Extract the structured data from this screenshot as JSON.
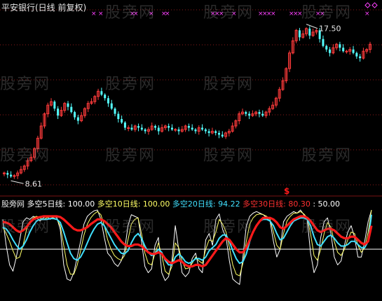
{
  "title": "平安银行(日线 前复权)",
  "watermark": "股旁网",
  "colors": {
    "background": "#000000",
    "up": "#ff3b3b",
    "down": "#54ffff",
    "grid": "#8b1a1a",
    "white": "#ffffff",
    "yellow": "#ffff66",
    "cyan": "#40e0ff",
    "red": "#ff1a1a",
    "magenta": "#ff40ff"
  },
  "legend": {
    "indicator": "股旁网",
    "s5_label": "多空5日线:",
    "s5_value": "100.00",
    "s10_label": "多空10日线:",
    "s10_value": "100.00",
    "s20_label": "多空20日线:",
    "s20_value": "94.22",
    "s30_label": "多空30日线:",
    "s30_value": "80.30",
    "level_value": ": 50.00"
  },
  "chart_data": [
    {
      "type": "candlestick",
      "title": "平安银行(日线 前复权)",
      "annotations": {
        "high": "17.50",
        "low": "8.61",
        "signal": "$"
      },
      "grid": true,
      "close": [
        8.9,
        8.8,
        8.7,
        8.75,
        8.9,
        9.1,
        9.3,
        9.6,
        9.8,
        10.3,
        10.9,
        11.6,
        12.3,
        12.8,
        13.0,
        12.6,
        12.2,
        12.5,
        12.9,
        12.7,
        12.4,
        12.1,
        11.9,
        12.2,
        12.6,
        12.9,
        13.0,
        13.3,
        13.6,
        13.4,
        13.2,
        12.9,
        12.6,
        12.3,
        12.0,
        11.8,
        11.5,
        11.5,
        11.4,
        11.6,
        11.5,
        11.4,
        11.3,
        11.4,
        11.6,
        11.5,
        11.3,
        11.5,
        11.6,
        11.5,
        11.4,
        11.4,
        11.3,
        11.4,
        11.6,
        11.5,
        11.4,
        11.3,
        11.5,
        11.4,
        11.3,
        11.2,
        11.3,
        11.2,
        11.1,
        11.0,
        11.2,
        11.3,
        11.6,
        11.9,
        12.3,
        12.4,
        12.3,
        12.2,
        12.3,
        12.4,
        12.3,
        12.2,
        12.4,
        12.6,
        12.8,
        13.2,
        13.7,
        14.2,
        14.9,
        15.8,
        16.5,
        17.1,
        16.7,
        16.9,
        17.2,
        16.8,
        17.0,
        17.1,
        16.6,
        16.2,
        16.0,
        15.8,
        16.1,
        16.3,
        16.1,
        15.9,
        15.9,
        16.0,
        15.8,
        15.6,
        15.5,
        15.9,
        16.0,
        16.3
      ]
    },
    {
      "type": "line",
      "series": [
        {
          "name": "多空5日线",
          "values": [
            88,
            55,
            30,
            22,
            40,
            62,
            85,
            90,
            88,
            92,
            90,
            86,
            90,
            92,
            88,
            92,
            90,
            75,
            30,
            12,
            10,
            20,
            40,
            60,
            82,
            92,
            96,
            99,
            100,
            88,
            65,
            45,
            40,
            32,
            28,
            35,
            48,
            80,
            94,
            92,
            90,
            60,
            28,
            20,
            25,
            55,
            65,
            20,
            10,
            15,
            35,
            80,
            50,
            20,
            15,
            20,
            38,
            45,
            25,
            20,
            62,
            70,
            55,
            88,
            95,
            75,
            65,
            35,
            12,
            8,
            5,
            40,
            80,
            92,
            96,
            98,
            96,
            94,
            90,
            86,
            60,
            40,
            50,
            85,
            92,
            95,
            98,
            96,
            100,
            94,
            88,
            45,
            20,
            30,
            65,
            85,
            90,
            70,
            40,
            30,
            35,
            55,
            72,
            80,
            65,
            40,
            40,
            60,
            85,
            100
          ]
        },
        {
          "name": "多空10日线",
          "values": [
            78,
            70,
            60,
            48,
            38,
            40,
            55,
            75,
            85,
            90,
            92,
            90,
            88,
            90,
            92,
            90,
            88,
            80,
            55,
            30,
            18,
            18,
            30,
            48,
            68,
            82,
            90,
            95,
            98,
            94,
            80,
            62,
            50,
            42,
            38,
            36,
            42,
            62,
            82,
            88,
            90,
            70,
            45,
            32,
            30,
            45,
            58,
            42,
            22,
            18,
            28,
            58,
            52,
            35,
            25,
            26,
            32,
            40,
            35,
            32,
            50,
            62,
            60,
            72,
            88,
            82,
            72,
            52,
            30,
            18,
            16,
            32,
            60,
            82,
            90,
            94,
            95,
            94,
            92,
            88,
            72,
            55,
            50,
            70,
            86,
            92,
            96,
            96,
            98,
            95,
            90,
            70,
            42,
            36,
            50,
            70,
            84,
            78,
            60,
            46,
            42,
            50,
            62,
            72,
            70,
            55,
            46,
            52,
            72,
            100
          ]
        },
        {
          "name": "多空20日线",
          "values": [
            78,
            76,
            70,
            62,
            55,
            50,
            54,
            62,
            72,
            80,
            86,
            88,
            88,
            88,
            89,
            89,
            88,
            84,
            72,
            58,
            45,
            38,
            36,
            40,
            48,
            58,
            68,
            76,
            82,
            84,
            80,
            72,
            64,
            56,
            50,
            45,
            44,
            48,
            58,
            66,
            70,
            64,
            54,
            46,
            42,
            44,
            50,
            46,
            36,
            30,
            30,
            40,
            44,
            40,
            34,
            32,
            34,
            38,
            38,
            36,
            40,
            48,
            52,
            56,
            64,
            68,
            68,
            60,
            48,
            38,
            32,
            34,
            44,
            60,
            72,
            80,
            86,
            88,
            88,
            86,
            80,
            70,
            62,
            64,
            72,
            80,
            86,
            88,
            90,
            90,
            88,
            80,
            66,
            56,
            54,
            60,
            66,
            68,
            64,
            58,
            54,
            54,
            56,
            60,
            60,
            56,
            52,
            52,
            60,
            94
          ]
        },
        {
          "name": "多空30日线",
          "values": [
            85,
            84,
            82,
            78,
            74,
            72,
            74,
            78,
            84,
            88,
            90,
            91,
            92,
            92,
            92,
            92,
            92,
            91,
            88,
            84,
            80,
            76,
            74,
            74,
            76,
            78,
            82,
            85,
            88,
            88,
            86,
            82,
            78,
            72,
            66,
            60,
            56,
            54,
            54,
            56,
            56,
            54,
            50,
            46,
            44,
            44,
            46,
            44,
            38,
            34,
            32,
            34,
            36,
            34,
            30,
            28,
            28,
            30,
            30,
            28,
            30,
            36,
            42,
            48,
            54,
            60,
            64,
            62,
            56,
            50,
            46,
            46,
            52,
            62,
            72,
            80,
            86,
            90,
            90,
            90,
            88,
            84,
            78,
            76,
            80,
            84,
            88,
            90,
            92,
            92,
            90,
            86,
            80,
            74,
            72,
            74,
            76,
            76,
            74,
            70,
            66,
            64,
            64,
            66,
            66,
            62,
            58,
            56,
            60,
            80
          ]
        }
      ],
      "reference_line": 50,
      "ylim": [
        0,
        100
      ]
    }
  ]
}
